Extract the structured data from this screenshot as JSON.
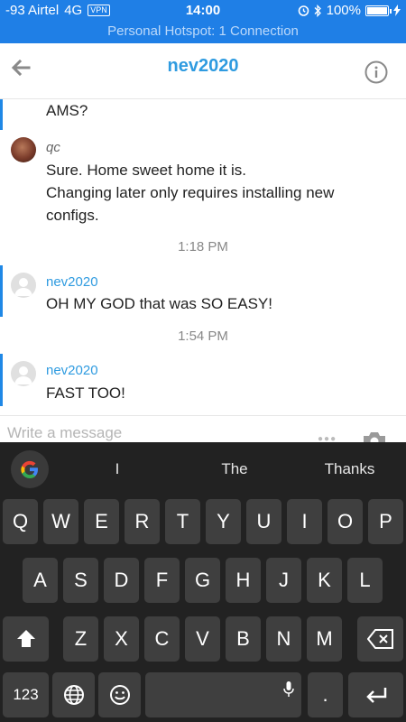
{
  "status_bar": {
    "carrier": "-93 Airtel",
    "network": "4G",
    "vpn": "VPN",
    "time": "14:00",
    "battery": "100%",
    "battery_level": 1.0,
    "hotspot": "Personal Hotspot: 1 Connection"
  },
  "header": {
    "title": "nev2020",
    "back_icon": "back-arrow-icon",
    "info_icon": "info-icon"
  },
  "messages": [
    {
      "type": "continuation",
      "text": "AMS?"
    },
    {
      "type": "message",
      "author": "qc",
      "lines": [
        "Sure. Home sweet home it is.",
        "Changing later only requires installing new configs."
      ]
    },
    {
      "type": "timestamp",
      "text": "1:18 PM"
    },
    {
      "type": "message",
      "author": "nev2020",
      "lines": [
        "OH MY GOD that was SO EASY!"
      ]
    },
    {
      "type": "timestamp",
      "text": "1:54 PM"
    },
    {
      "type": "message",
      "author": "nev2020",
      "lines": [
        "FAST TOO!"
      ]
    }
  ],
  "composer": {
    "placeholder": "Write a message",
    "more_icon": "more-dots-icon",
    "camera_icon": "camera-icon"
  },
  "keyboard": {
    "suggestions": [
      "I",
      "The",
      "Thanks"
    ],
    "row1": [
      "Q",
      "W",
      "E",
      "R",
      "T",
      "Y",
      "U",
      "I",
      "O",
      "P"
    ],
    "row2": [
      "A",
      "S",
      "D",
      "F",
      "G",
      "H",
      "J",
      "K",
      "L"
    ],
    "row3": [
      "Z",
      "X",
      "C",
      "V",
      "B",
      "N",
      "M"
    ],
    "numbers_key": "123",
    "period_key": ".",
    "icons": [
      "google-logo-icon",
      "shift-icon",
      "backspace-icon",
      "globe-icon",
      "emoji-icon",
      "microphone-icon",
      "return-icon"
    ]
  }
}
